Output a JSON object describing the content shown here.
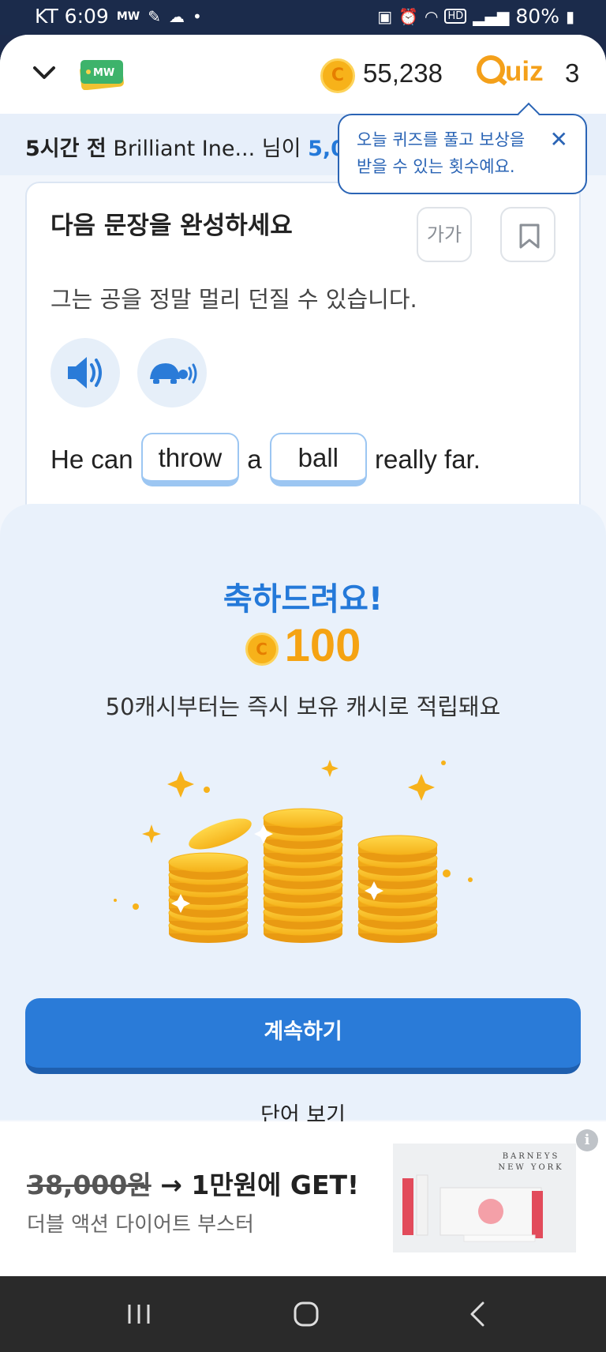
{
  "status_bar": {
    "carrier_time": "KT 6:09",
    "mw_label": "MW",
    "hd_label": "HD",
    "battery": "80%"
  },
  "header": {
    "coins": "55,238",
    "quiz_label": "uiz",
    "quiz_count": "3",
    "coin_glyph": "C"
  },
  "ticker": {
    "time": "5시간 전",
    "user": "Brilliant Ine...",
    "suffix": "님이",
    "amount": "5,0"
  },
  "tooltip": {
    "line1": "오늘 퀴즈를 풀고 보상을",
    "line2": "받을 수 있는 횟수예요.",
    "close": "✕"
  },
  "card": {
    "title": "다음 문장을 완성하세요",
    "font_button": "가가",
    "korean_sentence": "그는 공을 정말 멀리 던질 수 있습니다.",
    "sentence": {
      "part1": "He can",
      "word1": "throw",
      "part2": "a",
      "word2": "ball",
      "part3": "really far."
    }
  },
  "result": {
    "congrats": "축하드려요!",
    "coin_glyph": "C",
    "reward": "100",
    "note": "50캐시부터는 즉시 보유 캐시로 적립돼요",
    "continue_button": "계속하기",
    "view_words": "단어 보기"
  },
  "ad": {
    "old_price": "38,000원",
    "new_price": "→ 1만원에 GET!",
    "subtitle": "더블 액션 다이어트 부스터",
    "brand_line1": "BARNEYS",
    "brand_line2": "NEW YORK",
    "info": "i"
  },
  "colors": {
    "accent": "#2a7bd8",
    "coin": "#f5a313",
    "tooltip": "#2a64b5"
  }
}
